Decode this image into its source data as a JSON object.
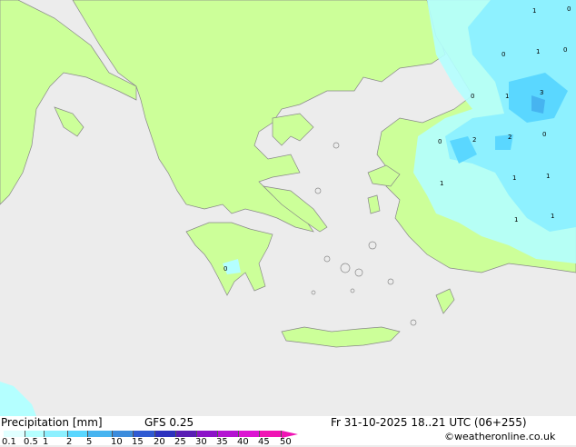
{
  "legend": {
    "title": "Precipitation [mm]",
    "model": "GFS 0.25",
    "ticks": [
      "0.1",
      "0.5",
      "1",
      "2",
      "5",
      "10",
      "15",
      "20",
      "25",
      "30",
      "35",
      "40",
      "45",
      "50"
    ],
    "colors": [
      "#e0ffff",
      "#b4ffff",
      "#8cf0ff",
      "#5ad7ff",
      "#46b4f0",
      "#3c8cdc",
      "#2f5ad2",
      "#2d32be",
      "#5a1eb4",
      "#8c14c8",
      "#b414d2",
      "#dc14d2",
      "#f014b4"
    ]
  },
  "datetime": "Fr 31-10-2025 18..21 UTC (06+255)",
  "credit": "©weatheronline.co.uk",
  "map_labels": [
    "1",
    "0",
    "0",
    "1",
    "0",
    "0",
    "1",
    "3",
    "0",
    "2",
    "2",
    "0",
    "1",
    "1",
    "1",
    "1",
    "1",
    "0"
  ],
  "colors": {
    "sea": "#ececec",
    "land": "#ccff99",
    "coast": "#888888",
    "precip_light": "#b4ffff",
    "precip_mid": "#8cf0ff",
    "precip_high": "#5ad7ff"
  }
}
